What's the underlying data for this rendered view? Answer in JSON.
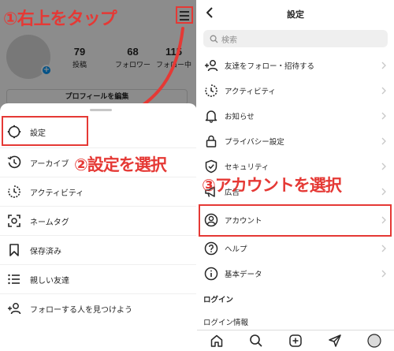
{
  "left": {
    "step_label": "①右上をタップ",
    "profile": {
      "stats": [
        {
          "num": "79",
          "label": "投稿"
        },
        {
          "num": "68",
          "label": "フォロワー"
        },
        {
          "num": "115",
          "label": "フォロー中"
        }
      ],
      "edit_button": "プロフィールを編集"
    },
    "menu": [
      {
        "label": "設定",
        "icon": "settings-gear-icon"
      },
      {
        "label": "アーカイブ",
        "icon": "archive-clock-icon"
      },
      {
        "label": "アクティビティ",
        "icon": "activity-icon"
      },
      {
        "label": "ネームタグ",
        "icon": "nametag-icon"
      },
      {
        "label": "保存済み",
        "icon": "bookmark-icon"
      },
      {
        "label": "親しい友達",
        "icon": "close-friends-list-icon"
      },
      {
        "label": "フォローする人を見つけよう",
        "icon": "add-person-icon"
      }
    ],
    "step2_label": "②設定を選択"
  },
  "right": {
    "title": "設定",
    "search_placeholder": "検索",
    "items": [
      {
        "label": "友達をフォロー・招待する",
        "icon": "add-person-icon"
      },
      {
        "label": "アクティビティ",
        "icon": "activity-icon"
      },
      {
        "label": "お知らせ",
        "icon": "bell-icon"
      },
      {
        "label": "プライバシー設定",
        "icon": "lock-icon"
      },
      {
        "label": "セキュリティ",
        "icon": "shield-icon"
      },
      {
        "label": "広告",
        "icon": "megaphone-icon"
      },
      {
        "label": "アカウント",
        "icon": "account-circle-icon"
      },
      {
        "label": "ヘルプ",
        "icon": "help-icon"
      },
      {
        "label": "基本データ",
        "icon": "info-icon"
      }
    ],
    "section_login": "ログイン",
    "login_info": "ログイン情報",
    "step3_label": "③アカウントを選択"
  },
  "colors": {
    "annotation_red": "#e53935",
    "link_blue": "#0095f6"
  }
}
